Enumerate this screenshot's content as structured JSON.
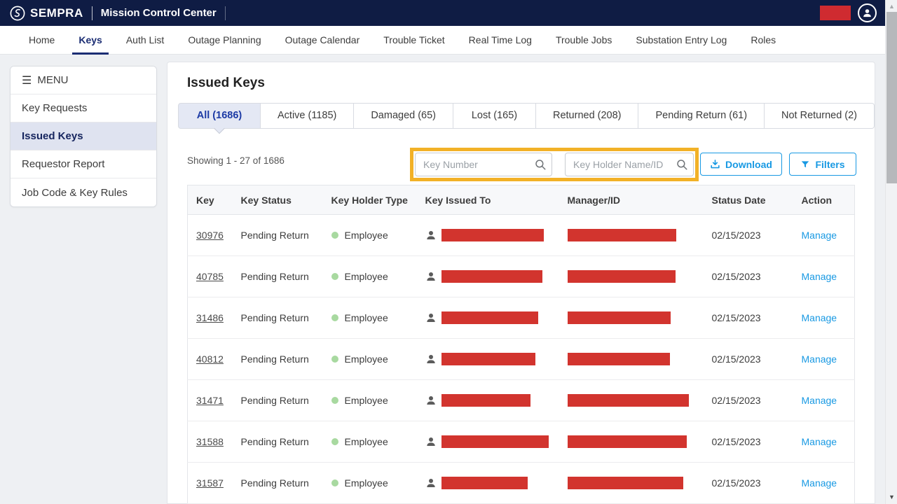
{
  "header": {
    "brand": "SEMPRA",
    "app_title": "Mission Control Center"
  },
  "nav": {
    "items": [
      {
        "label": "Home",
        "active": false
      },
      {
        "label": "Keys",
        "active": true
      },
      {
        "label": "Auth List",
        "active": false
      },
      {
        "label": "Outage Planning",
        "active": false
      },
      {
        "label": "Outage Calendar",
        "active": false
      },
      {
        "label": "Trouble Ticket",
        "active": false
      },
      {
        "label": "Real Time Log",
        "active": false
      },
      {
        "label": "Trouble Jobs",
        "active": false
      },
      {
        "label": "Substation Entry Log",
        "active": false
      },
      {
        "label": "Roles",
        "active": false
      }
    ]
  },
  "sidebar": {
    "menu_label": "MENU",
    "items": [
      {
        "label": "Key Requests",
        "active": false
      },
      {
        "label": "Issued Keys",
        "active": true
      },
      {
        "label": "Requestor Report",
        "active": false
      },
      {
        "label": "Job Code & Key Rules",
        "active": false
      }
    ]
  },
  "main": {
    "title": "Issued Keys",
    "tabs": [
      {
        "label": "All (1686)",
        "active": true
      },
      {
        "label": "Active (1185)",
        "active": false
      },
      {
        "label": "Damaged (65)",
        "active": false
      },
      {
        "label": "Lost (165)",
        "active": false
      },
      {
        "label": "Returned (208)",
        "active": false
      },
      {
        "label": "Pending Return (61)",
        "active": false
      },
      {
        "label": "Not Returned (2)",
        "active": false
      }
    ],
    "showing": "Showing 1 - 27 of 1686",
    "search": {
      "key_number_placeholder": "Key Number",
      "key_holder_placeholder": "Key Holder Name/ID"
    },
    "buttons": {
      "download": "Download",
      "filters": "Filters"
    },
    "table": {
      "columns": [
        "Key",
        "Key Status",
        "Key Holder Type",
        "Key Issued To",
        "Manager/ID",
        "Status Date",
        "Action"
      ],
      "rows": [
        {
          "key": "30976",
          "status": "Pending Return",
          "holder_type": "Employee",
          "status_date": "02/15/2023",
          "action": "Manage",
          "issued_bar_w": 146,
          "manager_bar_w": 155
        },
        {
          "key": "40785",
          "status": "Pending Return",
          "holder_type": "Employee",
          "status_date": "02/15/2023",
          "action": "Manage",
          "issued_bar_w": 144,
          "manager_bar_w": 154
        },
        {
          "key": "31486",
          "status": "Pending Return",
          "holder_type": "Employee",
          "status_date": "02/15/2023",
          "action": "Manage",
          "issued_bar_w": 138,
          "manager_bar_w": 147
        },
        {
          "key": "40812",
          "status": "Pending Return",
          "holder_type": "Employee",
          "status_date": "02/15/2023",
          "action": "Manage",
          "issued_bar_w": 134,
          "manager_bar_w": 146
        },
        {
          "key": "31471",
          "status": "Pending Return",
          "holder_type": "Employee",
          "status_date": "02/15/2023",
          "action": "Manage",
          "issued_bar_w": 127,
          "manager_bar_w": 173
        },
        {
          "key": "31588",
          "status": "Pending Return",
          "holder_type": "Employee",
          "status_date": "02/15/2023",
          "action": "Manage",
          "issued_bar_w": 153,
          "manager_bar_w": 170
        },
        {
          "key": "31587",
          "status": "Pending Return",
          "holder_type": "Employee",
          "status_date": "02/15/2023",
          "action": "Manage",
          "issued_bar_w": 123,
          "manager_bar_w": 165
        }
      ]
    }
  },
  "icons": {
    "logo": "sempra-circle-mark",
    "user": "person-icon",
    "menu": "hamburger-icon",
    "search": "magnifier-icon",
    "download": "download-tray-icon",
    "filters": "funnel-icon",
    "holder": "person-icon",
    "scroll_up": "▲",
    "scroll_down": "▼"
  },
  "colors": {
    "header_navy": "#0f1c44",
    "nav_active": "#1b2d73",
    "tab_active_text": "#1c3aa5",
    "tab_active_bg": "#e4e8f4",
    "accent_blue": "#1899e3",
    "redaction_red": "#d2342e",
    "header_redaction_red": "#cf2b30",
    "highlight_yellow": "#f2b127",
    "status_dot_green": "#a8d9a0",
    "sidebar_active_bg": "#dfe3f0"
  }
}
